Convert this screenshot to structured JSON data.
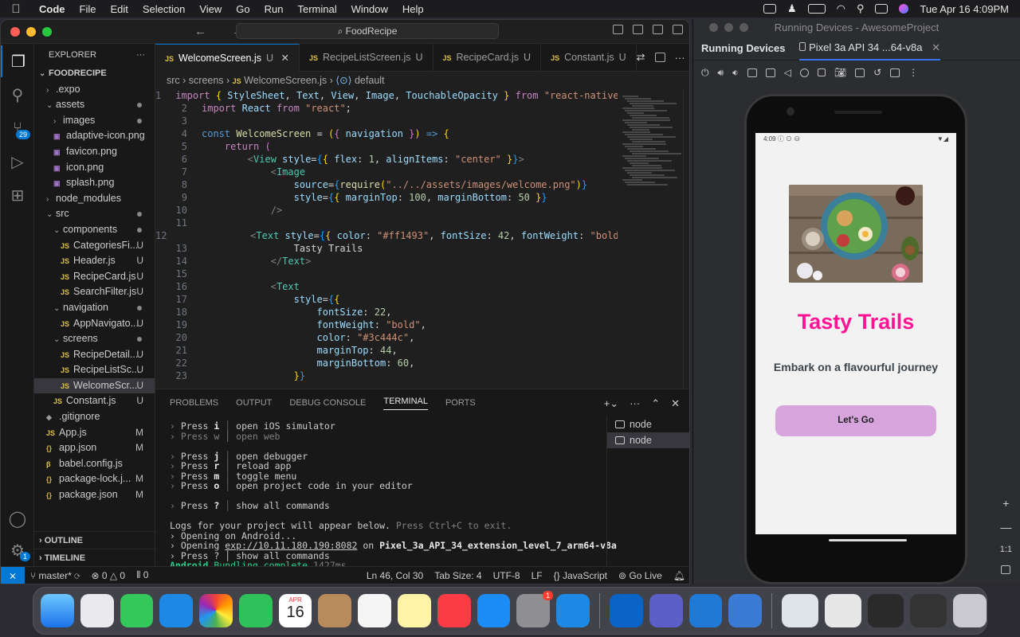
{
  "menubar": {
    "app_name": "Code",
    "items": [
      "File",
      "Edit",
      "Selection",
      "View",
      "Go",
      "Run",
      "Terminal",
      "Window",
      "Help"
    ],
    "clock": "Tue Apr 16  4:09PM"
  },
  "vscode": {
    "command_center": "FoodRecipe",
    "explorer_title": "EXPLORER",
    "root": "FOODRECIPE",
    "tree": [
      {
        "label": ".expo",
        "depth": 1,
        "kind": "folder",
        "open": false,
        "status": ""
      },
      {
        "label": "assets",
        "depth": 1,
        "kind": "folder",
        "open": true,
        "status": "dot"
      },
      {
        "label": "images",
        "depth": 2,
        "kind": "folder",
        "open": false,
        "status": "dot"
      },
      {
        "label": "adaptive-icon.png",
        "depth": 2,
        "kind": "img",
        "status": ""
      },
      {
        "label": "favicon.png",
        "depth": 2,
        "kind": "img",
        "status": ""
      },
      {
        "label": "icon.png",
        "depth": 2,
        "kind": "img",
        "status": ""
      },
      {
        "label": "splash.png",
        "depth": 2,
        "kind": "img",
        "status": ""
      },
      {
        "label": "node_modules",
        "depth": 1,
        "kind": "folder",
        "open": false,
        "status": ""
      },
      {
        "label": "src",
        "depth": 1,
        "kind": "folder",
        "open": true,
        "status": "dot"
      },
      {
        "label": "components",
        "depth": 2,
        "kind": "folder",
        "open": true,
        "status": "dot"
      },
      {
        "label": "CategoriesFi...",
        "depth": 3,
        "kind": "js",
        "status": "U"
      },
      {
        "label": "Header.js",
        "depth": 3,
        "kind": "js",
        "status": "U"
      },
      {
        "label": "RecipeCard.js",
        "depth": 3,
        "kind": "js",
        "status": "U"
      },
      {
        "label": "SearchFilter.js",
        "depth": 3,
        "kind": "js",
        "status": "U"
      },
      {
        "label": "navigation",
        "depth": 2,
        "kind": "folder",
        "open": true,
        "status": "dot"
      },
      {
        "label": "AppNavigato...",
        "depth": 3,
        "kind": "js",
        "status": "U"
      },
      {
        "label": "screens",
        "depth": 2,
        "kind": "folder",
        "open": true,
        "status": "dot"
      },
      {
        "label": "RecipeDetail...",
        "depth": 3,
        "kind": "js",
        "status": "U"
      },
      {
        "label": "RecipeListSc...",
        "depth": 3,
        "kind": "js",
        "status": "U"
      },
      {
        "label": "WelcomeScr...",
        "depth": 3,
        "kind": "js",
        "status": "U",
        "selected": true
      },
      {
        "label": "Constant.js",
        "depth": 2,
        "kind": "js",
        "status": "U"
      },
      {
        "label": ".gitignore",
        "depth": 1,
        "kind": "git",
        "status": ""
      },
      {
        "label": "App.js",
        "depth": 1,
        "kind": "js",
        "status": "M"
      },
      {
        "label": "app.json",
        "depth": 1,
        "kind": "json",
        "status": "M"
      },
      {
        "label": "babel.config.js",
        "depth": 1,
        "kind": "babel",
        "status": ""
      },
      {
        "label": "package-lock.j...",
        "depth": 1,
        "kind": "json",
        "status": "M"
      },
      {
        "label": "package.json",
        "depth": 1,
        "kind": "json",
        "status": "M"
      }
    ],
    "outline_label": "OUTLINE",
    "timeline_label": "TIMELINE",
    "source_control_badge": "29",
    "settings_badge": "1",
    "tabs": [
      {
        "label": "WelcomeScreen.js",
        "status": "U",
        "active": true
      },
      {
        "label": "RecipeListScreen.js",
        "status": "U",
        "active": false
      },
      {
        "label": "RecipeCard.js",
        "status": "U",
        "active": false
      },
      {
        "label": "Constant.js",
        "status": "U",
        "active": false
      }
    ],
    "breadcrumb": [
      "src",
      "screens",
      "WelcomeScreen.js",
      "default"
    ],
    "code_lines": [
      {
        "n": "1",
        "html": "<span class='kw'>import</span> <span class='br'>{</span> <span class='var'>StyleSheet</span>, <span class='var'>Text</span>, <span class='var'>View</span>, <span class='var'>Image</span>, <span class='var'>TouchableOpacity</span> <span class='br'>}</span> <span class='kw'>from</span> <span class='str'>\"react-native\"</span>;"
      },
      {
        "n": "2",
        "html": "<span class='kw'>import</span> <span class='var'>React</span> <span class='kw'>from</span> <span class='str'>\"react\"</span>;"
      },
      {
        "n": "3",
        "html": ""
      },
      {
        "n": "4",
        "html": "<span class='bl'>const</span> <span class='fn'>WelcomeScreen</span> = <span class='br'>(</span><span class='br2'>{</span> <span class='var'>navigation</span> <span class='br2'>}</span><span class='br'>)</span> <span class='bl'>=&gt;</span> <span class='br'>{</span>"
      },
      {
        "n": "5",
        "html": "    <span class='kw'>return</span> <span class='br2'>(</span>"
      },
      {
        "n": "6",
        "html": "        <span class='dim'>&lt;</span><span class='tag'>View</span> <span class='var'>style</span>=<span class='br3'>{</span><span class='br'>{</span> <span class='var'>flex</span>: <span class='num'>1</span>, <span class='var'>alignItems</span>: <span class='str'>\"center\"</span> <span class='br'>}</span><span class='br3'>}</span><span class='dim'>&gt;</span>"
      },
      {
        "n": "7",
        "html": "            <span class='dim'>&lt;</span><span class='tag'>Image</span>"
      },
      {
        "n": "8",
        "html": "                <span class='var'>source</span>=<span class='br3'>{</span><span class='fn'>require</span><span class='br'>(</span><span class='str'>\"../../assets/images/welcome.png\"</span><span class='br'>)</span><span class='br3'>}</span>"
      },
      {
        "n": "9",
        "html": "                <span class='var'>style</span>=<span class='br3'>{</span><span class='br'>{</span> <span class='var'>marginTop</span>: <span class='num'>100</span>, <span class='var'>marginBottom</span>: <span class='num'>50</span> <span class='br'>}</span><span class='br3'>}</span>"
      },
      {
        "n": "10",
        "html": "            <span class='dim'>/&gt;</span>"
      },
      {
        "n": "11",
        "html": ""
      },
      {
        "n": "12",
        "html": "            <span class='dim'>&lt;</span><span class='tag'>Text</span> <span class='var'>style</span>=<span class='br3'>{</span><span class='br'>{</span> <span class='var'>color</span>: <span class='str'>\"#ff1493\"</span>, <span class='var'>fontSize</span>: <span class='num'>42</span>, <span class='var'>fontWeight</span>: <span class='str'>\"bold\"</span> <span class='br'>}</span><span class='br3'>}</span><span class='dim'>&gt;</span>"
      },
      {
        "n": "13",
        "html": "                Tasty Trails"
      },
      {
        "n": "14",
        "html": "            <span class='dim'>&lt;/</span><span class='tag'>Text</span><span class='dim'>&gt;</span>"
      },
      {
        "n": "15",
        "html": ""
      },
      {
        "n": "16",
        "html": "            <span class='dim'>&lt;</span><span class='tag'>Text</span>"
      },
      {
        "n": "17",
        "html": "                <span class='var'>style</span>=<span class='br3'>{</span><span class='br'>{</span>"
      },
      {
        "n": "18",
        "html": "                    <span class='var'>fontSize</span>: <span class='num'>22</span>,"
      },
      {
        "n": "19",
        "html": "                    <span class='var'>fontWeight</span>: <span class='str'>\"bold\"</span>,"
      },
      {
        "n": "20",
        "html": "                    <span class='var'>color</span>: <span class='str'>\"#3c444c\"</span>,"
      },
      {
        "n": "21",
        "html": "                    <span class='var'>marginTop</span>: <span class='num'>44</span>,"
      },
      {
        "n": "22",
        "html": "                    <span class='var'>marginBottom</span>: <span class='num'>60</span>,"
      },
      {
        "n": "23",
        "html": "                <span class='br'>}</span><span class='br3'>}</span>"
      }
    ],
    "panel_tabs": [
      {
        "label": "PROBLEMS",
        "active": false
      },
      {
        "label": "OUTPUT",
        "active": false
      },
      {
        "label": "DEBUG CONSOLE",
        "active": false
      },
      {
        "label": "TERMINAL",
        "active": true
      },
      {
        "label": "PORTS",
        "active": false
      }
    ],
    "terminal_lines": [
      {
        "html": "<span class='dim'>›</span> Press <span class='bold'>i</span> <span class='sep'>│</span> open iOS simulator"
      },
      {
        "html": "<span class='dim'>› Press w │ open web</span>"
      },
      {
        "html": ""
      },
      {
        "html": "<span class='dim'>›</span> Press <span class='bold'>j</span> <span class='sep'>│</span> open debugger"
      },
      {
        "html": "<span class='dim'>›</span> Press <span class='bold'>r</span> <span class='sep'>│</span> reload app"
      },
      {
        "html": "<span class='dim'>›</span> Press <span class='bold'>m</span> <span class='sep'>│</span> toggle menu"
      },
      {
        "html": "<span class='dim'>›</span> Press <span class='bold'>o</span> <span class='sep'>│</span> open project code in your editor"
      },
      {
        "html": ""
      },
      {
        "html": "<span class='dim'>›</span> Press <span class='bold'>?</span> <span class='sep'>│</span> show all commands"
      },
      {
        "html": ""
      },
      {
        "html": "Logs for your project will appear below. <span class='dim'>Press Ctrl+C to exit.</span>"
      },
      {
        "html": "› Opening on Android..."
      },
      {
        "html": "› Opening <span class='und'>exp://10.11.180.190:8082</span> on <span class='bold'>Pixel_3a_API_34_extension_level_7_arm64-v8a</span>"
      },
      {
        "html": "› Press ? │ show all commands"
      },
      {
        "html": "<span class='grn'>Android</span> <span class='grn2'>Bundling complete</span> <span class='dim'>1427ms</span>"
      },
      {
        "html": "▯"
      }
    ],
    "terminals": [
      "node",
      "node"
    ],
    "status": {
      "branch": "master*",
      "errors": "0",
      "warnings": "0",
      "ports": "0",
      "position": "Ln 46, Col 30",
      "tab_size": "Tab Size: 4",
      "encoding": "UTF-8",
      "eol": "LF",
      "language": "JavaScript",
      "go_live": "Go Live"
    }
  },
  "devices": {
    "window_title": "Running Devices - AwesomeProject",
    "tab_label": "Running Devices",
    "device_tab": "Pixel 3a API 34 ...64-v8a",
    "zoom_label": "1:1",
    "phone": {
      "time": "4:09",
      "title": "Tasty Trails",
      "subtitle": "Embark on a flavourful journey",
      "button": "Let's Go"
    }
  },
  "dock": {
    "calendar_month": "APR",
    "calendar_day": "16",
    "settings_badge": "1"
  }
}
